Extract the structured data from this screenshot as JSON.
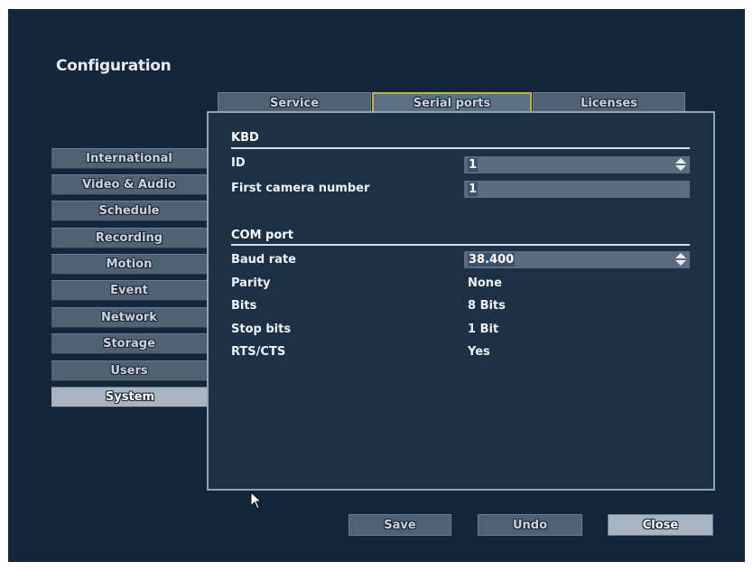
{
  "window": {
    "title": "Configuration"
  },
  "tabs": [
    {
      "label": "Service",
      "active": false
    },
    {
      "label": "Serial ports",
      "active": true
    },
    {
      "label": "Licenses",
      "active": false
    }
  ],
  "sidebar": {
    "items": [
      {
        "label": "International",
        "active": false
      },
      {
        "label": "Video & Audio",
        "active": false
      },
      {
        "label": "Schedule",
        "active": false
      },
      {
        "label": "Recording",
        "active": false
      },
      {
        "label": "Motion",
        "active": false
      },
      {
        "label": "Event",
        "active": false
      },
      {
        "label": "Network",
        "active": false
      },
      {
        "label": "Storage",
        "active": false
      },
      {
        "label": "Users",
        "active": false
      },
      {
        "label": "System",
        "active": true
      }
    ]
  },
  "kbd": {
    "heading": "KBD",
    "id_label": "ID",
    "id_value": "1",
    "first_camera_label": "First camera number",
    "first_camera_value": "1"
  },
  "com": {
    "heading": "COM port",
    "baud_label": "Baud rate",
    "baud_value": "38.400",
    "parity_label": "Parity",
    "parity_value": "None",
    "bits_label": "Bits",
    "bits_value": "8 Bits",
    "stop_label": "Stop bits",
    "stop_value": "1 Bit",
    "rts_label": "RTS/CTS",
    "rts_value": "Yes"
  },
  "buttons": {
    "save": "Save",
    "undo": "Undo",
    "close": "Close"
  },
  "colors": {
    "background": "#13263b",
    "panel": "#1c3145",
    "tab": "#4f6274",
    "active_highlight": "#a7b4c2",
    "active_tab_border": "#c9b23a"
  },
  "icons": [
    "spin-updown-icon",
    "mouse-cursor-icon"
  ]
}
